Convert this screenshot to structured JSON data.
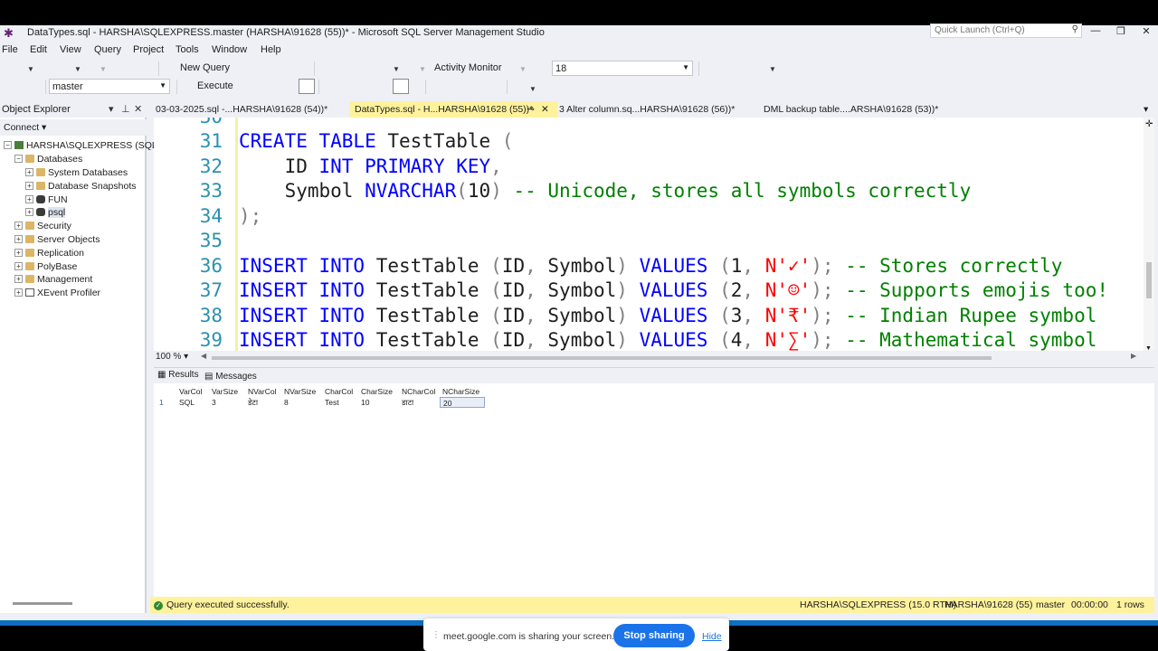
{
  "window": {
    "title": "DataTypes.sql - HARSHA\\SQLEXPRESS.master (HARSHA\\91628 (55))* - Microsoft SQL Server Management Studio",
    "quick_launch_placeholder": "Quick Launch (Ctrl+Q)",
    "minimize": "—",
    "restore": "❐",
    "close": "✕"
  },
  "menu": [
    "File",
    "Edit",
    "View",
    "Query",
    "Project",
    "Tools",
    "Window",
    "Help"
  ],
  "toolbar": {
    "new_query": "New Query",
    "activity_monitor": "Activity Monitor",
    "font_size": "18",
    "database": "master",
    "execute": "Execute"
  },
  "object_explorer": {
    "title": "Object Explorer",
    "connect": "Connect",
    "server": "HARSHA\\SQLEXPRESS (SQL S",
    "databases": "Databases",
    "db_children": [
      "System Databases",
      "Database Snapshots",
      "FUN",
      "psql"
    ],
    "nodes": [
      "Security",
      "Server Objects",
      "Replication",
      "PolyBase",
      "Management",
      "XEvent Profiler"
    ]
  },
  "tabs": [
    {
      "label": "03-03-2025.sql -...HARSHA\\91628 (54))*",
      "active": false
    },
    {
      "label": "DataTypes.sql - H...HARSHA\\91628 (55))*",
      "active": true
    },
    {
      "label": "3 Alter column.sq...HARSHA\\91628 (56))*",
      "active": false
    },
    {
      "label": "DML backup table....ARSHA\\91628 (53))*",
      "active": false
    }
  ],
  "editor": {
    "partial_line_number": "30",
    "lines": [
      {
        "n": "31",
        "parts": [
          [
            "kw",
            "CREATE TABLE"
          ],
          [
            "id",
            " TestTable "
          ],
          [
            "pu",
            "("
          ]
        ]
      },
      {
        "n": "32",
        "parts": [
          [
            "id",
            "    ID "
          ],
          [
            "kw",
            "INT PRIMARY KEY"
          ],
          [
            "pu",
            ","
          ]
        ]
      },
      {
        "n": "33",
        "parts": [
          [
            "id",
            "    Symbol "
          ],
          [
            "kw",
            "NVARCHAR"
          ],
          [
            "pu",
            "("
          ],
          [
            "nu",
            "10"
          ],
          [
            "pu",
            ")"
          ],
          [
            "cm",
            " -- Unicode, stores all symbols correctly"
          ]
        ]
      },
      {
        "n": "34",
        "parts": [
          [
            "pu",
            ");"
          ]
        ]
      },
      {
        "n": "35",
        "parts": []
      },
      {
        "n": "36",
        "parts": [
          [
            "kw",
            "INSERT INTO"
          ],
          [
            "id",
            " TestTable "
          ],
          [
            "pu",
            "("
          ],
          [
            "id",
            "ID"
          ],
          [
            "pu",
            ", "
          ],
          [
            "id",
            "Symbol"
          ],
          [
            "pu",
            ") "
          ],
          [
            "kw",
            "VALUES "
          ],
          [
            "pu",
            "("
          ],
          [
            "nu",
            "1"
          ],
          [
            "pu",
            ", "
          ],
          [
            "str",
            "N'✓'"
          ],
          [
            "pu",
            ");"
          ],
          [
            "cm",
            " -- Stores correctly"
          ]
        ]
      },
      {
        "n": "37",
        "parts": [
          [
            "kw",
            "INSERT INTO"
          ],
          [
            "id",
            " TestTable "
          ],
          [
            "pu",
            "("
          ],
          [
            "id",
            "ID"
          ],
          [
            "pu",
            ", "
          ],
          [
            "id",
            "Symbol"
          ],
          [
            "pu",
            ") "
          ],
          [
            "kw",
            "VALUES "
          ],
          [
            "pu",
            "("
          ],
          [
            "nu",
            "2"
          ],
          [
            "pu",
            ", "
          ],
          [
            "str",
            "N'☺'"
          ],
          [
            "pu",
            ");"
          ],
          [
            "cm",
            " -- Supports emojis too!"
          ]
        ]
      },
      {
        "n": "38",
        "parts": [
          [
            "kw",
            "INSERT INTO"
          ],
          [
            "id",
            " TestTable "
          ],
          [
            "pu",
            "("
          ],
          [
            "id",
            "ID"
          ],
          [
            "pu",
            ", "
          ],
          [
            "id",
            "Symbol"
          ],
          [
            "pu",
            ") "
          ],
          [
            "kw",
            "VALUES "
          ],
          [
            "pu",
            "("
          ],
          [
            "nu",
            "3"
          ],
          [
            "pu",
            ", "
          ],
          [
            "str",
            "N'₹'"
          ],
          [
            "pu",
            ");"
          ],
          [
            "cm",
            " -- Indian Rupee symbol"
          ]
        ]
      },
      {
        "n": "39",
        "parts": [
          [
            "kw",
            "INSERT INTO"
          ],
          [
            "id",
            " TestTable "
          ],
          [
            "pu",
            "("
          ],
          [
            "id",
            "ID"
          ],
          [
            "pu",
            ", "
          ],
          [
            "id",
            "Symbol"
          ],
          [
            "pu",
            ") "
          ],
          [
            "kw",
            "VALUES "
          ],
          [
            "pu",
            "("
          ],
          [
            "nu",
            "4"
          ],
          [
            "pu",
            ", "
          ],
          [
            "str",
            "N'∑'"
          ],
          [
            "pu",
            ");"
          ],
          [
            "cm",
            " -- Mathematical symbol"
          ]
        ]
      }
    ]
  },
  "zoom": "100 %",
  "results": {
    "tab_results": "Results",
    "tab_messages": "Messages",
    "columns": [
      "VarCol",
      "VarSize",
      "NVarCol",
      "NVarSize",
      "CharCol",
      "CharSize",
      "NCharCol",
      "NCharSize"
    ],
    "rows": [
      {
        "row_num": "1",
        "cells": [
          "SQL",
          "3",
          "डेटा",
          "8",
          "Test",
          "10",
          "डाटा",
          "20"
        ]
      }
    ]
  },
  "status": {
    "message": "Query executed successfully.",
    "server": "HARSHA\\SQLEXPRESS (15.0 RTM)",
    "user": "HARSHA\\91628 (55)",
    "db": "master",
    "time": "00:00:00",
    "rows": "1 rows"
  },
  "share_banner": {
    "text": "meet.google.com is sharing your screen.",
    "stop": "Stop sharing",
    "hide": "Hide"
  }
}
